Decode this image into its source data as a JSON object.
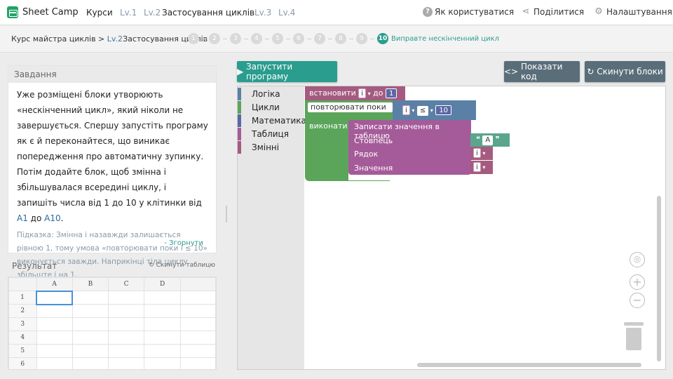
{
  "brand": {
    "name": "Sheet Camp",
    "color": "#21a366"
  },
  "nav": {
    "courses": "Курси",
    "lv1": "Lv.1",
    "lv2": "Lv.2",
    "lv2_title": "Застосування циклів",
    "lv3": "Lv.3",
    "lv4": "Lv.4"
  },
  "top_right": {
    "help": "Як користуватися",
    "share": "Поділитися",
    "settings": "Налаштування"
  },
  "breadcrumb": {
    "course": "Курс майстра циклів",
    "sep": " > ",
    "level": "Lv.2",
    "title": "Застосування циклів"
  },
  "steps": [
    "1",
    "2",
    "3",
    "4",
    "5",
    "6",
    "7",
    "8",
    "9"
  ],
  "active_step": {
    "num": "10",
    "label": "Виправте нескінченний цикл"
  },
  "task": {
    "header": "Завдання",
    "text_1": "Уже розміщені блоки утворюють «нескінченний цикл», який ніколи не завершується. Спершу запустіть програму як є й переконайтеся, що виникає попередження про автоматичну зупинку. Потім додайте блок, щоб змінна i збільшувалася всередині циклу, і запишіть числа від 1 до 10 у клітинки від ",
    "cell_a1": "A1",
    "text_2": " до ",
    "cell_a10": "A10",
    "text_3": ".",
    "hint": "Підказка: Змінна i назавжди залишається рівною 1, тому умова «повторювати поки i ≤ 10» виконується завжди. Наприкінці тіла циклу збільште i на 1.",
    "collapse": "- Згорнути"
  },
  "result": {
    "title": "Результат",
    "reset": "Скинути таблицю"
  },
  "sheet": {
    "columns": [
      "A",
      "B",
      "C",
      "D"
    ],
    "rows": [
      "1",
      "2",
      "3",
      "4",
      "5",
      "6"
    ]
  },
  "buttons": {
    "run": "Запустити програму",
    "show_code": "Показати код",
    "reset_blocks": "Скинути блоки"
  },
  "toolbox": [
    {
      "label": "Логіка",
      "color": "#5b80a5"
    },
    {
      "label": "Цикли",
      "color": "#5ba55b"
    },
    {
      "label": "Математика",
      "color": "#5b67a5"
    },
    {
      "label": "Таблиця",
      "color": "#a55b99"
    },
    {
      "label": "Змінні",
      "color": "#a55b80"
    }
  ],
  "blocks": {
    "set": {
      "label": "встановити",
      "var": "i",
      "to": "до",
      "value": "1",
      "color": "#a55b80"
    },
    "repeat": {
      "label": "повторювати поки",
      "do": "виконати",
      "color": "#5ba55b"
    },
    "compare": {
      "var": "i",
      "op": "≤",
      "value": "10",
      "color": "#5b80a5"
    },
    "write": {
      "label": "Записати значення в таблицю",
      "col": "Стовпець",
      "row": "Рядок",
      "val": "Значення",
      "color": "#a55b99"
    },
    "text": {
      "value": "A",
      "color": "#5ba58c"
    },
    "row_var": "i",
    "val_var": "i"
  }
}
